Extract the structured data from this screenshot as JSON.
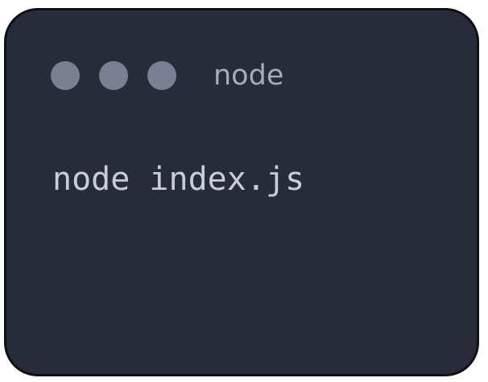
{
  "window": {
    "title": "node",
    "controls": [
      {
        "name": "window-control-1",
        "color": "#7b7f93"
      },
      {
        "name": "window-control-2",
        "color": "#7b7f93"
      },
      {
        "name": "window-control-3",
        "color": "#7b7f93"
      }
    ]
  },
  "terminal": {
    "command": "node index.js"
  },
  "colors": {
    "background": "#272b3a",
    "border": "#0f1014",
    "title_text": "#a7abbd",
    "command_text": "#c9ccdc"
  }
}
